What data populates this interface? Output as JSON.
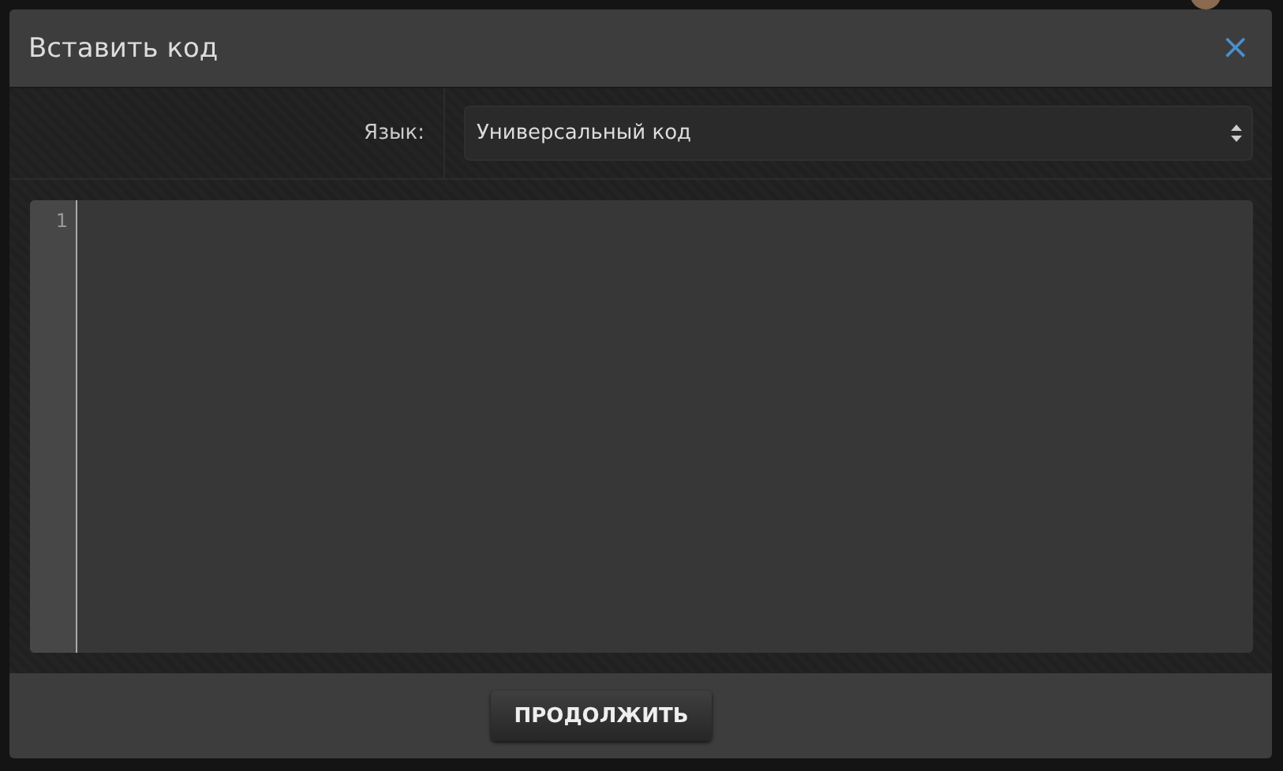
{
  "dialog": {
    "title": "Вставить код",
    "close": "×"
  },
  "language": {
    "label": "Язык:",
    "value": "Универсальный код"
  },
  "editor": {
    "line_numbers": [
      "1"
    ]
  },
  "buttons": [
    "ПРОДОЛЖИТЬ"
  ]
}
